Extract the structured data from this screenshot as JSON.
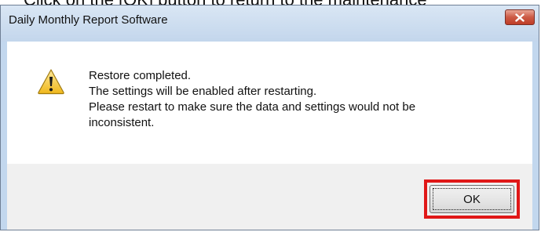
{
  "instruction": {
    "text": "Click on the [OK] button to return to the maintenance"
  },
  "dialog": {
    "title": "Daily Monthly Report Software",
    "icon": "warning-icon",
    "message_lines": [
      "Restore completed.",
      "The settings will be enabled after restarting.",
      "Please restart to make sure the data and settings would not be",
      "inconsistent."
    ],
    "ok_label": "OK",
    "close_icon": "close-icon"
  },
  "colors": {
    "highlight": "#e01818",
    "title_bar": "#c3d6ec",
    "close_button": "#cc5a45",
    "footer": "#f0f0f0"
  }
}
